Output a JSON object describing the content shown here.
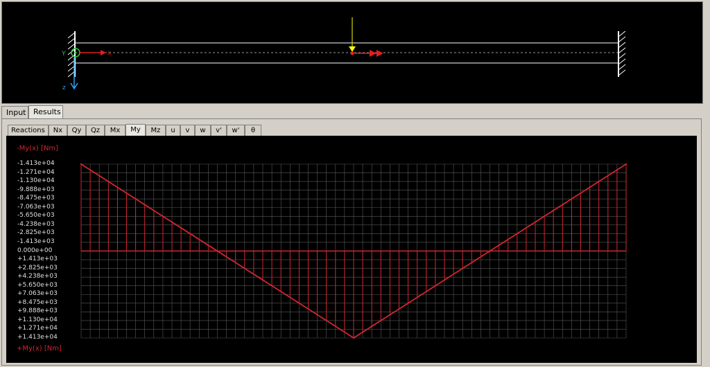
{
  "beam_view": {
    "axis_y_label": "Y",
    "axis_x_label": "x",
    "axis_z_label": "z"
  },
  "main_tabs": [
    {
      "label": "Input",
      "active": false
    },
    {
      "label": "Results",
      "active": true
    }
  ],
  "sub_tabs": [
    {
      "label": "Reactions",
      "active": false
    },
    {
      "label": "Nx",
      "active": false
    },
    {
      "label": "Qy",
      "active": false
    },
    {
      "label": "Qz",
      "active": false
    },
    {
      "label": "Mx",
      "active": false
    },
    {
      "label": "My",
      "active": true
    },
    {
      "label": "Mz",
      "active": false
    },
    {
      "label": "u",
      "active": false
    },
    {
      "label": "v",
      "active": false
    },
    {
      "label": "w",
      "active": false
    },
    {
      "label": "v'",
      "active": false
    },
    {
      "label": "w'",
      "active": false
    },
    {
      "label": "θ",
      "active": false
    }
  ],
  "colors": {
    "diagram": "#d0272f",
    "grid": "#5a5a5a",
    "beam": "#ffffff",
    "load": "#ffff00"
  },
  "chart_data": {
    "type": "line",
    "top_label": "-My(x) [Nm]",
    "bottom_label": "+My(x) [Nm]",
    "y_ticks": [
      "-1.413e+04",
      "-1.271e+04",
      "-1.130e+04",
      "-9.888e+03",
      "-8.475e+03",
      "-7.063e+03",
      "-5.650e+03",
      "-4.238e+03",
      "-2.825e+03",
      "-1.413e+03",
      "0.000e+00",
      "+1.413e+03",
      "+2.825e+03",
      "+4.238e+03",
      "+5.650e+03",
      "+7.063e+03",
      "+8.475e+03",
      "+9.888e+03",
      "+1.130e+04",
      "+1.271e+04",
      "+1.413e+04"
    ],
    "ylim": [
      -14130,
      14130
    ],
    "y_inverted": true,
    "x": [
      0,
      0.5,
      1
    ],
    "series": [
      {
        "values": [
          -14130,
          14130,
          -14130
        ]
      }
    ],
    "grid": true
  }
}
